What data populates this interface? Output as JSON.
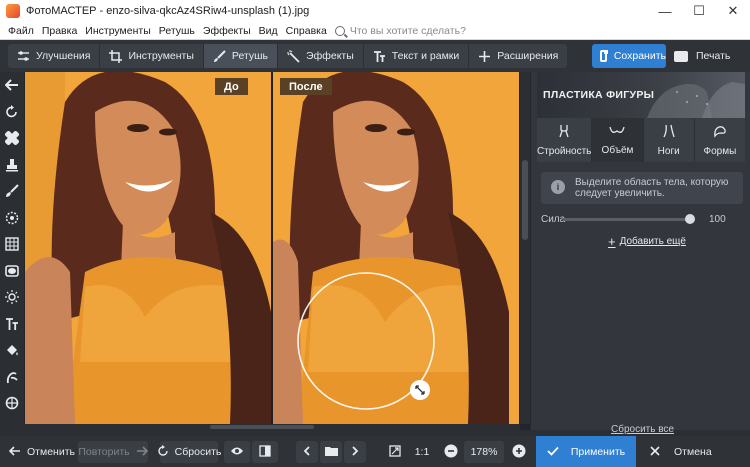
{
  "window": {
    "title": "ФотоМАСТЕР - enzo-silva-qkcAz4SRiw4-unsplash (1).jpg",
    "minimize_icon": "—",
    "maximize_icon": "☐",
    "close_icon": "✕"
  },
  "menu": {
    "items": [
      "Файл",
      "Правка",
      "Инструменты",
      "Ретушь",
      "Эффекты",
      "Вид",
      "Справка"
    ],
    "search_placeholder": "Что вы хотите сделать?"
  },
  "toolbar": {
    "tabs": [
      {
        "label": "Улучшения",
        "icon": "sliders-icon",
        "active": false
      },
      {
        "label": "Инструменты",
        "icon": "crop-icon",
        "active": false
      },
      {
        "label": "Ретушь",
        "icon": "brush-icon",
        "active": true
      },
      {
        "label": "Эффекты",
        "icon": "magic-wand-icon",
        "active": false
      },
      {
        "label": "Текст и рамки",
        "icon": "text-icon",
        "active": false
      },
      {
        "label": "Расширения",
        "icon": "plus-icon",
        "active": false
      }
    ],
    "save_label": "Сохранить",
    "print_label": "Печать",
    "accent_color": "#2f7fd3"
  },
  "left_tools": [
    "back-arrow-icon",
    "rotate-icon",
    "healing-icon",
    "stamp-icon",
    "brush-icon",
    "radial-icon",
    "grid-icon",
    "vignette-icon",
    "sun-icon",
    "text-icon",
    "fill-icon",
    "body-shape-icon",
    "reset-icon"
  ],
  "canvas": {
    "before_label": "До",
    "after_label": "После",
    "photo_bg_color": "#f2a53a"
  },
  "panel": {
    "title": "ПЛАСТИКА ФИГУРЫ",
    "tabs": [
      {
        "label": "Стройность",
        "icon": "body-icon",
        "active": false
      },
      {
        "label": "Объём",
        "icon": "volume-icon",
        "active": true
      },
      {
        "label": "Ноги",
        "icon": "legs-icon",
        "active": false
      },
      {
        "label": "Формы",
        "icon": "shapes-icon",
        "active": false
      }
    ],
    "hint_text": "Выделите область тела, которую следует увеличить.",
    "strength_label": "Сила",
    "strength_value": "100",
    "strength_level": 1.0,
    "add_more_label": "Добавить ещё",
    "reset_all_label": "Сбросить все"
  },
  "bottom": {
    "undo_label": "Отменить",
    "redo_label": "Повторить",
    "reset_label": "Сбросить",
    "ratio_label": "1:1",
    "zoom_value": "178%",
    "apply_label": "Применить",
    "cancel_label": "Отмена"
  }
}
